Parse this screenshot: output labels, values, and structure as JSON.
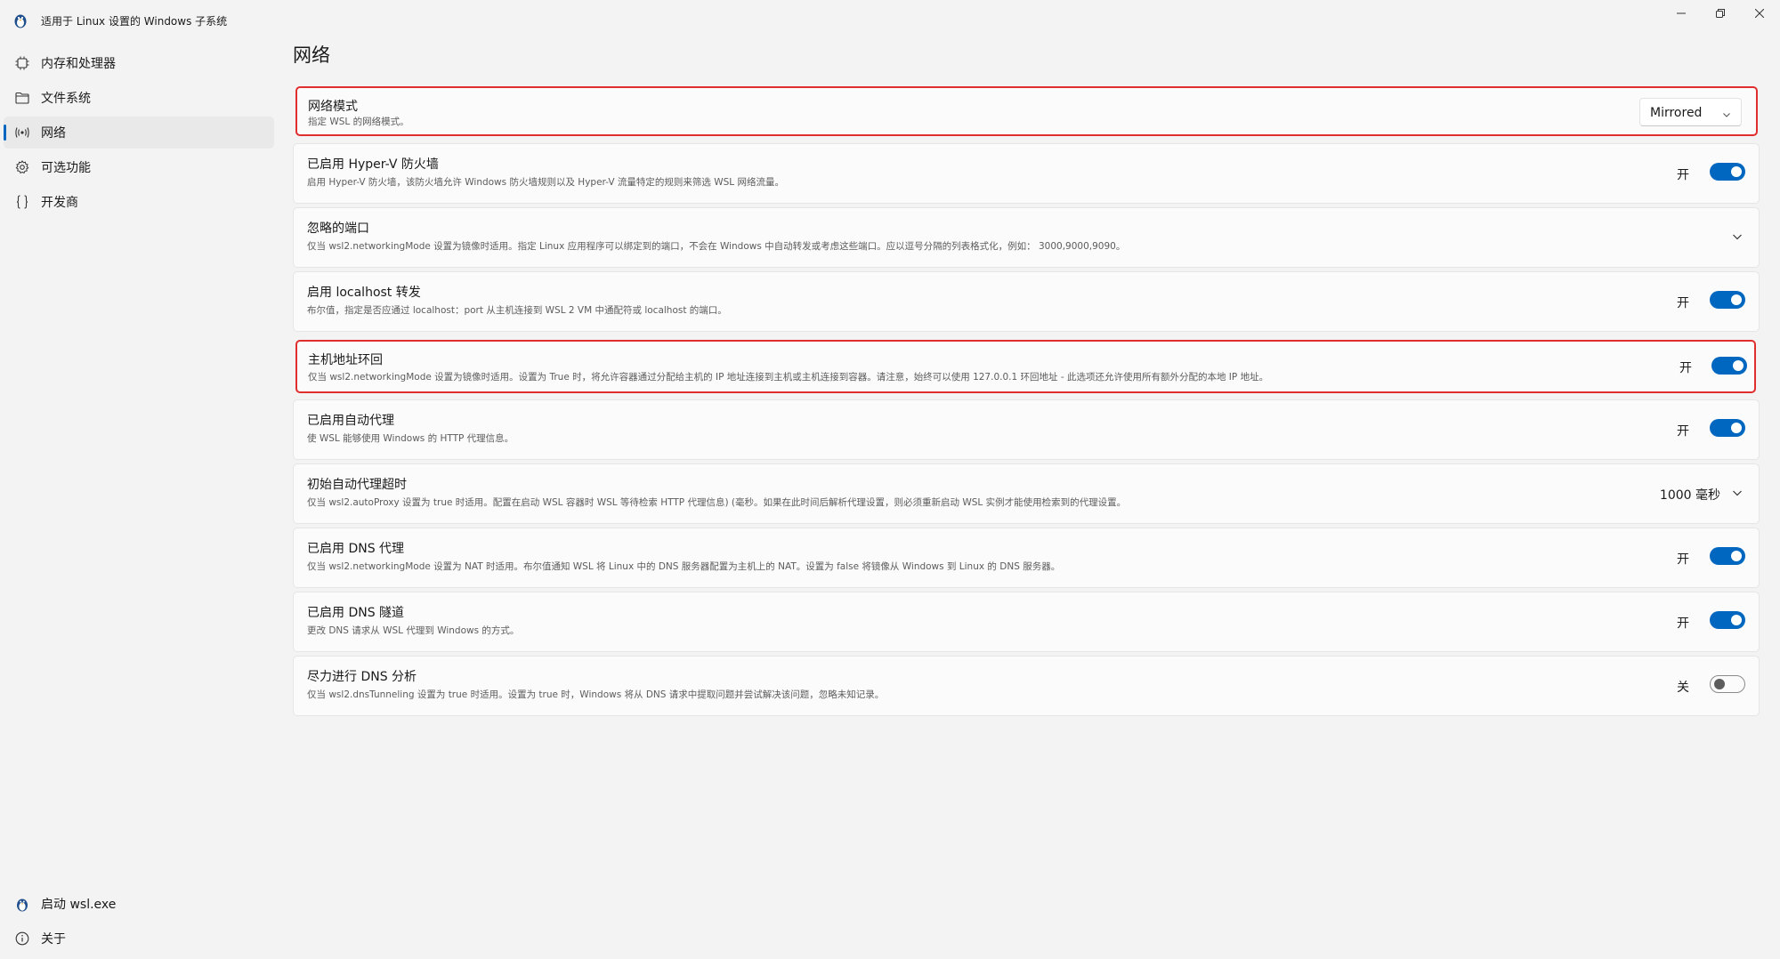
{
  "window": {
    "title": "适用于 Linux 设置的 Windows 子系统",
    "controls": [
      "minimize",
      "restore",
      "close"
    ]
  },
  "sidebar": {
    "items": [
      {
        "label": "内存和处理器",
        "icon": "chip-icon"
      },
      {
        "label": "文件系统",
        "icon": "folder-icon"
      },
      {
        "label": "网络",
        "icon": "network-icon",
        "selected": true
      },
      {
        "label": "可选功能",
        "icon": "gear-icon"
      },
      {
        "label": "开发商",
        "icon": "braces-icon"
      }
    ],
    "bottom": [
      {
        "label": "启动 wsl.exe",
        "icon": "penguin-icon"
      },
      {
        "label": "关于",
        "icon": "info-icon"
      }
    ]
  },
  "page": {
    "title": "网络"
  },
  "settings": [
    {
      "title": "网络模式",
      "description": "指定 WSL 的网络模式。",
      "control": "dropdown",
      "value": "Mirrored",
      "highlighted": true
    },
    {
      "title": "已启用 Hyper-V 防火墙",
      "description": "启用 Hyper-V 防火墙，该防火墙允许 Windows 防火墙规则以及 Hyper-V 流量特定的规则来筛选 WSL 网络流量。",
      "control": "toggle",
      "state_label": "开",
      "on": true
    },
    {
      "title": "忽略的端口",
      "description": "仅当 wsl2.networkingMode 设置为镜像时适用。指定 Linux 应用程序可以绑定到的端口，不会在 Windows 中自动转发或考虑这些端口。应以逗号分隔的列表格式化，例如：  3000,9000,9090。",
      "control": "expander"
    },
    {
      "title": "启用 localhost 转发",
      "description": "布尔值，指定是否应通过 localhost：port 从主机连接到 WSL 2 VM 中通配符或 localhost 的端口。",
      "control": "toggle",
      "state_label": "开",
      "on": true
    },
    {
      "title": "主机地址环回",
      "description": "仅当 wsl2.networkingMode 设置为镜像时适用。设置为 True 时，将允许容器通过分配给主机的 IP 地址连接到主机或主机连接到容器。请注意，始终可以使用 127.0.0.1 环回地址 - 此选项还允许使用所有额外分配的本地 IP 地址。",
      "control": "toggle",
      "state_label": "开",
      "on": true,
      "highlighted": true
    },
    {
      "title": "已启用自动代理",
      "description": "使 WSL 能够使用 Windows 的 HTTP 代理信息。",
      "control": "toggle",
      "state_label": "开",
      "on": true
    },
    {
      "title": "初始自动代理超时",
      "description": "仅当 wsl2.autoProxy 设置为 true 时适用。配置在启动 WSL 容器时 WSL 等待检索 HTTP 代理信息) (毫秒。如果在此时间后解析代理设置，则必须重新启动 WSL 实例才能使用检索到的代理设置。",
      "control": "expander-value",
      "value": "1000 毫秒"
    },
    {
      "title": "已启用 DNS 代理",
      "description": "仅当 wsl2.networkingMode 设置为 NAT 时适用。布尔值通知 WSL 将 Linux 中的 DNS 服务器配置为主机上的 NAT。设置为 false 将镜像从 Windows 到 Linux 的 DNS 服务器。",
      "control": "toggle",
      "state_label": "开",
      "on": true
    },
    {
      "title": "已启用 DNS 隧道",
      "description": "更改 DNS 请求从 WSL 代理到 Windows 的方式。",
      "control": "toggle",
      "state_label": "开",
      "on": true
    },
    {
      "title": "尽力进行 DNS 分析",
      "description": "仅当 wsl2.dnsTunneling 设置为 true 时适用。设置为 true 时，Windows 将从 DNS 请求中提取问题并尝试解决该问题，忽略未知记录。",
      "control": "toggle",
      "state_label": "关",
      "on": false
    }
  ],
  "colors": {
    "accent": "#0067c0",
    "highlight_border": "#e02d2d",
    "background": "#f3f3f3",
    "card": "#fbfbfb"
  }
}
